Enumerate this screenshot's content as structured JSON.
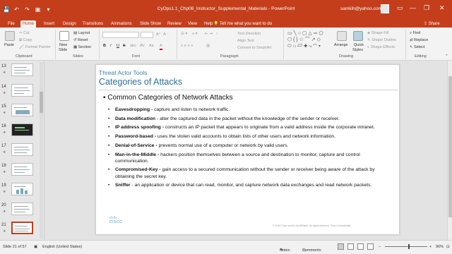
{
  "window": {
    "doc_title": "CyOps1.1_Chp08_Instructor_Supplemental_Materials - PowerPoint",
    "account": "samkih@yahoo.com",
    "qat": {
      "save": "💾",
      "undo": "↶",
      "redo": "↷",
      "start": "▣",
      "customize": "▾"
    },
    "controls": {
      "ribbon_options": "▭",
      "minimize": "—",
      "restore": "❐",
      "close": "✕"
    }
  },
  "ribbon_tabs": [
    "File",
    "Home",
    "Insert",
    "Design",
    "Transitions",
    "Animations",
    "Slide Show",
    "Review",
    "View",
    "Help"
  ],
  "active_tab": "Home",
  "tell_me": "Tell me what you want to do",
  "share": "Share",
  "ribbon": {
    "clipboard": {
      "paste": "Paste",
      "cut": "Cut",
      "copy": "Copy",
      "format_painter": "Format Painter",
      "label": "Clipboard"
    },
    "slides": {
      "new_slide": "New",
      "new_slide2": "Slide",
      "layout": "Layout",
      "reset": "Reset",
      "section": "Section",
      "label": "Slides"
    },
    "font": {
      "label": "Font",
      "bold": "B",
      "italic": "I",
      "underline": "U",
      "strike": "S",
      "shadow": "abc",
      "spacing": "AV",
      "case": "Aa",
      "color": "A"
    },
    "paragraph": {
      "label": "Paragraph",
      "text_direction": "Text Direction",
      "align_text": "Align Text",
      "smartart": "Convert to SmartArt"
    },
    "drawing": {
      "label": "Drawing",
      "arrange": "Arrange",
      "quick_styles": "Quick",
      "quick_styles2": "Styles",
      "shape_fill": "Shape Fill",
      "shape_outline": "Shape Outline",
      "shape_effects": "Shape Effects"
    },
    "editing": {
      "label": "Editing",
      "find": "Find",
      "replace": "Replace",
      "select": "Select"
    }
  },
  "thumbnails": [
    {
      "num": "13"
    },
    {
      "num": "14"
    },
    {
      "num": "15"
    },
    {
      "num": "16"
    },
    {
      "num": "17"
    },
    {
      "num": "18"
    },
    {
      "num": "19"
    },
    {
      "num": "20"
    },
    {
      "num": "21"
    }
  ],
  "slide": {
    "supertitle": "Threat Actor Tools",
    "title": "Categories of Attacks",
    "level1": "Common Categories of Network Attacks",
    "bullets": [
      {
        "term": "Eavesdropping -",
        "text": " capture and listen to network traffic."
      },
      {
        "term": "Data modification",
        "text": " - alter the captured data in the packet without the knowledge of the sender or receiver."
      },
      {
        "term": "IP address spoofing -",
        "text": " constructs an IP packet that appears to originate from a valid address inside the corporate intranet."
      },
      {
        "term": "Password-based -",
        "text": " uses the stolen valid accounts to obtain lists of other users and network information."
      },
      {
        "term": "Denial-of-Service -",
        "text": " prevents normal use of a computer or network by valid users."
      },
      {
        "term": "Man-in-the-Middle -",
        "text": " hackers position themselves between a source and destination to monitor, capture and control communication."
      },
      {
        "term": "Compromised-Key -",
        "text": " gain access to a secured communication without the sender or receiver being aware of the attack by obtaining the secret key."
      },
      {
        "term": "Sniffer",
        "text": " - an application or device that can read, monitor, and capture network data exchanges and read network packets."
      }
    ],
    "logo": "CISCO",
    "footer": "© 2016 Cisco and/or its affiliates. All rights reserved. Cisco Confidential"
  },
  "status": {
    "slide_of": "Slide 21 of 57",
    "language": "English (United States)",
    "notes": "Notes",
    "comments": "Comments",
    "zoom": "96%"
  },
  "colors": {
    "accent": "#c43e1c",
    "title_blue": "#2e6f99"
  }
}
